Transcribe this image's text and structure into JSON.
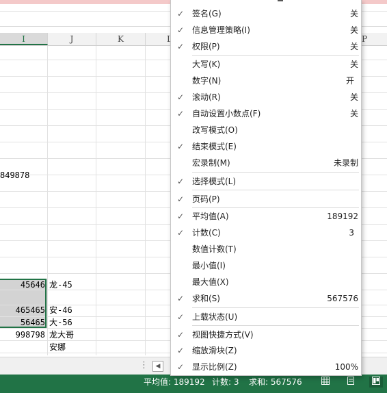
{
  "columns": [
    "I",
    "J",
    "K",
    "L",
    "P"
  ],
  "cells": {
    "i_row9": "849878",
    "i_row16": "45646",
    "j_row16": "龙-45",
    "i_row18": "465465",
    "j_row18": "安-46",
    "i_row19": "56465",
    "j_row19": "大-56",
    "i_row20": "998798",
    "j_row20": "龙大哥",
    "j_row21": "安娜"
  },
  "menu": {
    "items": [
      {
        "label": "签名(G)",
        "value": "关",
        "checked": true
      },
      {
        "label": "信息管理策略(I)",
        "value": "关",
        "checked": true
      },
      {
        "label": "权限(P)",
        "value": "关",
        "checked": true
      },
      {
        "label": "大写(K)",
        "value": "关",
        "checked": false
      },
      {
        "label": "数字(N)",
        "value": "开",
        "checked": false
      },
      {
        "label": "滚动(R)",
        "value": "关",
        "checked": true
      },
      {
        "label": "自动设置小数点(F)",
        "value": "关",
        "checked": true
      },
      {
        "label": "改写模式(O)",
        "value": "",
        "checked": false
      },
      {
        "label": "结束模式(E)",
        "value": "",
        "checked": true
      },
      {
        "label": "宏录制(M)",
        "value": "未录制",
        "checked": false
      },
      {
        "label": "选择模式(L)",
        "value": "",
        "checked": true
      },
      {
        "label": "页码(P)",
        "value": "",
        "checked": true
      },
      {
        "label": "平均值(A)",
        "value": "189192",
        "checked": true
      },
      {
        "label": "计数(C)",
        "value": "3",
        "checked": true
      },
      {
        "label": "数值计数(T)",
        "value": "",
        "checked": false
      },
      {
        "label": "最小值(I)",
        "value": "",
        "checked": false
      },
      {
        "label": "最大值(X)",
        "value": "",
        "checked": false
      },
      {
        "label": "求和(S)",
        "value": "567576",
        "checked": true
      },
      {
        "label": "上载状态(U)",
        "value": "",
        "checked": true
      },
      {
        "label": "视图快捷方式(V)",
        "value": "",
        "checked": true
      },
      {
        "label": "缩放滑块(Z)",
        "value": "",
        "checked": true
      },
      {
        "label": "显示比例(Z)",
        "value": "100%",
        "checked": true
      }
    ],
    "check_mark": "✓"
  },
  "statusbar": {
    "average": "平均值: 189192",
    "count": "计数: 3",
    "sum": "求和: 567576"
  },
  "scrollbar": {
    "dots": "⋮",
    "left_arrow": "◀"
  },
  "colors": {
    "accent": "#217346",
    "selection": "#d3d3d3"
  }
}
